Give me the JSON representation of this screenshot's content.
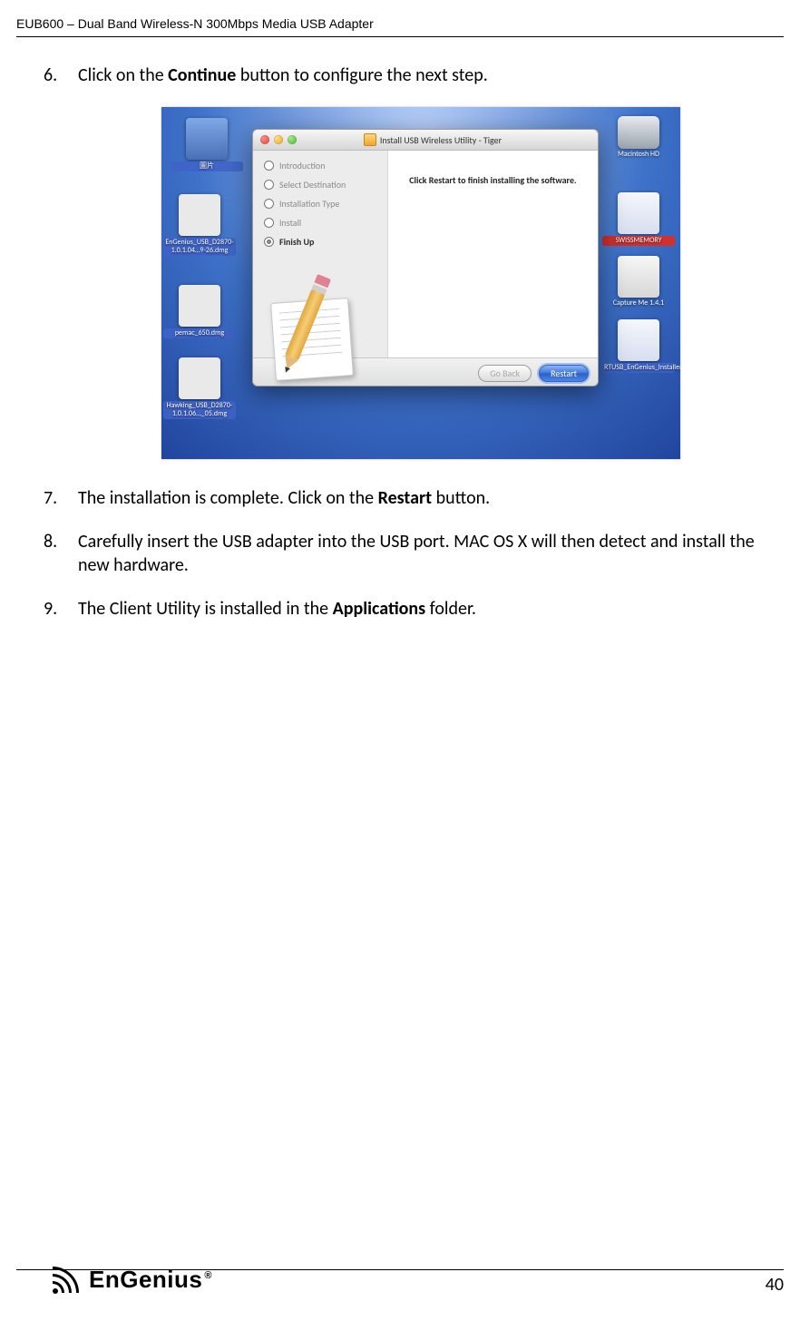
{
  "header": {
    "title": "EUB600 – Dual Band Wireless-N 300Mbps Media USB Adapter"
  },
  "steps": {
    "s6": {
      "num": "6.",
      "pre": "Click on the ",
      "bold": "Continue",
      "post": " button to configure the next step."
    },
    "s7": {
      "num": "7.",
      "pre": "The installation is complete. Click on the ",
      "bold": "Restart",
      "post": " button."
    },
    "s8": {
      "num": "8.",
      "text": "Carefully insert the USB adapter into the USB port. MAC OS X will then detect and install the new hardware."
    },
    "s9": {
      "num": "9.",
      "pre": "The Client Utility is installed in the ",
      "bold": "Applications",
      "post": " folder."
    }
  },
  "screenshot": {
    "window_title": "Install USB Wireless Utility - Tiger",
    "message": "Click Restart to finish installing the software.",
    "steps": {
      "intro": "Introduction",
      "dest": "Select Destination",
      "type": "Installation Type",
      "install": "Install",
      "finish": "Finish Up"
    },
    "buttons": {
      "back": "Go Back",
      "restart": "Restart"
    },
    "desktop": {
      "l1": "圖片",
      "l2": "EnGenius_USB_D2870-1.0.1.04…9-26.dmg",
      "l3": "pemac_650.dmg",
      "l4": "Hawking_USB_D2870-1.0.1.06…_05.dmg",
      "r1": "Macintosh HD",
      "r2": "SWISSMEMORY",
      "r3": "Capture Me 1.4.1",
      "r4": "RTUSB_EnGenius_Installer"
    }
  },
  "footer": {
    "page": "40",
    "brand": "EnGenius",
    "reg": "®"
  }
}
